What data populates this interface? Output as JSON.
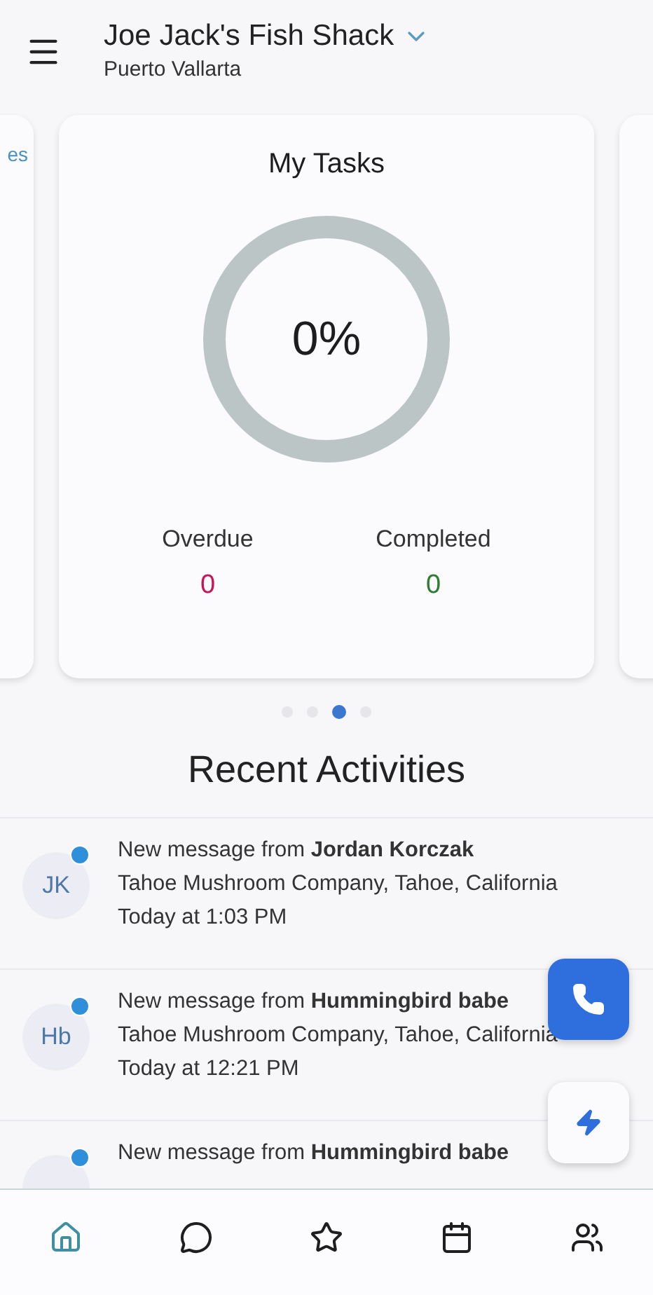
{
  "header": {
    "title": "Joe Jack's Fish Shack",
    "subtitle": "Puerto Vallarta"
  },
  "carousel": {
    "left_peek_text": "es",
    "card": {
      "title": "My Tasks",
      "percent": "0%",
      "stats": [
        {
          "label": "Overdue",
          "value": "0",
          "color": "#c2185b"
        },
        {
          "label": "Completed",
          "value": "0",
          "color": "#2e7d32"
        }
      ]
    },
    "dots": [
      {
        "selected": false
      },
      {
        "selected": false
      },
      {
        "selected": true
      },
      {
        "selected": false
      }
    ]
  },
  "activities": {
    "title": "Recent Activities",
    "items": [
      {
        "initials": "JK",
        "unread": true,
        "headline": "New message from **Jordan Korczak**",
        "location": "Tahoe Mushroom Company, Tahoe, California",
        "time": "Today at 1:03 PM"
      },
      {
        "initials": "Hb",
        "unread": true,
        "headline": "New message from **Hummingbird babe**",
        "location": "Tahoe Mushroom Company, Tahoe, California",
        "time": "Today at 12:21 PM"
      },
      {
        "unread": true,
        "headline": "New message from **Hummingbird babe**"
      }
    ]
  },
  "bottom_nav": [
    {
      "selected": true
    },
    {
      "selected": false
    },
    {
      "selected": false
    },
    {
      "selected": false
    },
    {
      "selected": false
    }
  ]
}
